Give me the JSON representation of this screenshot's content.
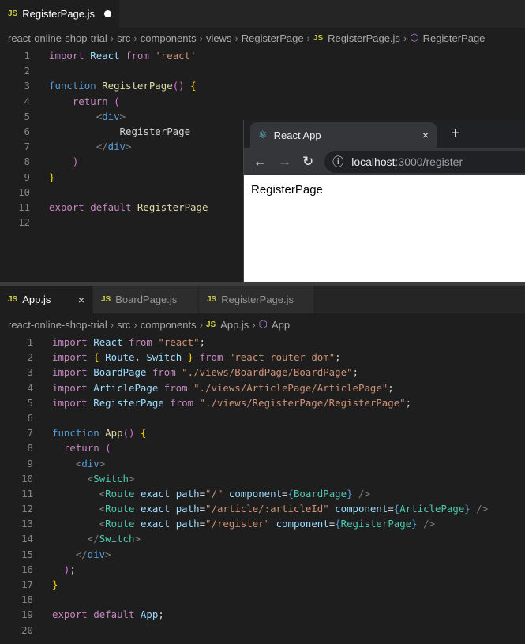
{
  "top_editor": {
    "tab": {
      "label": "RegisterPage.js",
      "icon": "JS"
    },
    "breadcrumb": [
      "react-online-shop-trial",
      "src",
      "components",
      "views",
      "RegisterPage",
      "RegisterPage.js",
      "RegisterPage"
    ],
    "lines": [
      [
        [
          "import",
          "kw"
        ],
        [
          " ",
          "pu"
        ],
        [
          "React",
          "id"
        ],
        [
          " ",
          "pu"
        ],
        [
          "from",
          "kw"
        ],
        [
          " ",
          "pu"
        ],
        [
          "'react'",
          "str"
        ]
      ],
      [],
      [
        [
          "function",
          "fn"
        ],
        [
          " ",
          "pu"
        ],
        [
          "RegisterPage",
          "fname"
        ],
        [
          "()",
          "br2"
        ],
        [
          " ",
          "pu"
        ],
        [
          "{",
          "br"
        ]
      ],
      [
        [
          "    ",
          "pu"
        ],
        [
          "return",
          "kw"
        ],
        [
          " ",
          "pu"
        ],
        [
          "(",
          "br2"
        ]
      ],
      [
        [
          "        ",
          "pu"
        ],
        [
          "<",
          "tag"
        ],
        [
          "div",
          "el"
        ],
        [
          ">",
          "tag"
        ]
      ],
      [
        [
          "            ",
          "pu"
        ],
        [
          "RegisterPage",
          "pu"
        ]
      ],
      [
        [
          "        ",
          "pu"
        ],
        [
          "</",
          "tag"
        ],
        [
          "div",
          "el"
        ],
        [
          ">",
          "tag"
        ]
      ],
      [
        [
          "    ",
          "pu"
        ],
        [
          ")",
          "br2"
        ]
      ],
      [
        [
          "}",
          "br"
        ]
      ],
      [],
      [
        [
          "export",
          "kw"
        ],
        [
          " ",
          "pu"
        ],
        [
          "default",
          "kw"
        ],
        [
          " ",
          "pu"
        ],
        [
          "RegisterPage",
          "fname"
        ]
      ],
      []
    ]
  },
  "browser": {
    "tab_title": "React App",
    "close": "×",
    "new_tab": "+",
    "back": "←",
    "forward": "→",
    "reload": "↻",
    "info": "ⓘ",
    "url_host": "localhost",
    "url_rest": ":3000/register",
    "content": "RegisterPage"
  },
  "bottom_editor": {
    "tabs": [
      {
        "label": "App.js",
        "icon": "JS",
        "close": "×"
      },
      {
        "label": "BoardPage.js",
        "icon": "JS"
      },
      {
        "label": "RegisterPage.js",
        "icon": "JS"
      }
    ],
    "breadcrumb": [
      "react-online-shop-trial",
      "src",
      "components",
      "App.js",
      "App"
    ],
    "lines": [
      [
        [
          "import",
          "kw"
        ],
        [
          " ",
          "pu"
        ],
        [
          "React",
          "id"
        ],
        [
          " ",
          "pu"
        ],
        [
          "from",
          "kw"
        ],
        [
          " ",
          "pu"
        ],
        [
          "\"react\"",
          "str"
        ],
        [
          ";",
          "pu"
        ]
      ],
      [
        [
          "import",
          "kw"
        ],
        [
          " ",
          "pu"
        ],
        [
          "{",
          "br"
        ],
        [
          " ",
          "pu"
        ],
        [
          "Route",
          "id"
        ],
        [
          ", ",
          "pu"
        ],
        [
          "Switch",
          "id"
        ],
        [
          " ",
          "pu"
        ],
        [
          "}",
          "br"
        ],
        [
          " ",
          "pu"
        ],
        [
          "from",
          "kw"
        ],
        [
          " ",
          "pu"
        ],
        [
          "\"react-router-dom\"",
          "str"
        ],
        [
          ";",
          "pu"
        ]
      ],
      [
        [
          "import",
          "kw"
        ],
        [
          " ",
          "pu"
        ],
        [
          "BoardPage",
          "id"
        ],
        [
          " ",
          "pu"
        ],
        [
          "from",
          "kw"
        ],
        [
          " ",
          "pu"
        ],
        [
          "\"./views/BoardPage/BoardPage\"",
          "str"
        ],
        [
          ";",
          "pu"
        ]
      ],
      [
        [
          "import",
          "kw"
        ],
        [
          " ",
          "pu"
        ],
        [
          "ArticlePage",
          "id"
        ],
        [
          " ",
          "pu"
        ],
        [
          "from",
          "kw"
        ],
        [
          " ",
          "pu"
        ],
        [
          "\"./views/ArticlePage/ArticlePage\"",
          "str"
        ],
        [
          ";",
          "pu"
        ]
      ],
      [
        [
          "import",
          "kw"
        ],
        [
          " ",
          "pu"
        ],
        [
          "RegisterPage",
          "id"
        ],
        [
          " ",
          "pu"
        ],
        [
          "from",
          "kw"
        ],
        [
          " ",
          "pu"
        ],
        [
          "\"./views/RegisterPage/RegisterPage\"",
          "str"
        ],
        [
          ";",
          "pu"
        ]
      ],
      [],
      [
        [
          "function",
          "fn"
        ],
        [
          " ",
          "pu"
        ],
        [
          "App",
          "fname"
        ],
        [
          "()",
          "br2"
        ],
        [
          " ",
          "pu"
        ],
        [
          "{",
          "br"
        ]
      ],
      [
        [
          "  ",
          "pu"
        ],
        [
          "return",
          "kw"
        ],
        [
          " ",
          "pu"
        ],
        [
          "(",
          "br2"
        ]
      ],
      [
        [
          "    ",
          "pu"
        ],
        [
          "<",
          "tag"
        ],
        [
          "div",
          "el"
        ],
        [
          ">",
          "tag"
        ]
      ],
      [
        [
          "      ",
          "pu"
        ],
        [
          "<",
          "tag"
        ],
        [
          "Switch",
          "comp"
        ],
        [
          ">",
          "tag"
        ]
      ],
      [
        [
          "        ",
          "pu"
        ],
        [
          "<",
          "tag"
        ],
        [
          "Route",
          "comp"
        ],
        [
          " ",
          "pu"
        ],
        [
          "exact",
          "at"
        ],
        [
          " ",
          "pu"
        ],
        [
          "path",
          "at"
        ],
        [
          "=",
          "pu"
        ],
        [
          "\"/\"",
          "str"
        ],
        [
          " ",
          "pu"
        ],
        [
          "component",
          "at"
        ],
        [
          "=",
          "pu"
        ],
        [
          "{",
          "fn"
        ],
        [
          "BoardPage",
          "comp"
        ],
        [
          "}",
          "fn"
        ],
        [
          " ",
          "pu"
        ],
        [
          "/>",
          "tag"
        ]
      ],
      [
        [
          "        ",
          "pu"
        ],
        [
          "<",
          "tag"
        ],
        [
          "Route",
          "comp"
        ],
        [
          " ",
          "pu"
        ],
        [
          "exact",
          "at"
        ],
        [
          " ",
          "pu"
        ],
        [
          "path",
          "at"
        ],
        [
          "=",
          "pu"
        ],
        [
          "\"/article/:articleId\"",
          "str"
        ],
        [
          " ",
          "pu"
        ],
        [
          "component",
          "at"
        ],
        [
          "=",
          "pu"
        ],
        [
          "{",
          "fn"
        ],
        [
          "ArticlePage",
          "comp"
        ],
        [
          "}",
          "fn"
        ],
        [
          " ",
          "pu"
        ],
        [
          "/>",
          "tag"
        ]
      ],
      [
        [
          "        ",
          "pu"
        ],
        [
          "<",
          "tag"
        ],
        [
          "Route",
          "comp"
        ],
        [
          " ",
          "pu"
        ],
        [
          "exact",
          "at"
        ],
        [
          " ",
          "pu"
        ],
        [
          "path",
          "at"
        ],
        [
          "=",
          "pu"
        ],
        [
          "\"/register\"",
          "str"
        ],
        [
          " ",
          "pu"
        ],
        [
          "component",
          "at"
        ],
        [
          "=",
          "pu"
        ],
        [
          "{",
          "fn"
        ],
        [
          "RegisterPage",
          "comp"
        ],
        [
          "}",
          "fn"
        ],
        [
          " ",
          "pu"
        ],
        [
          "/>",
          "tag"
        ]
      ],
      [
        [
          "      ",
          "pu"
        ],
        [
          "</",
          "tag"
        ],
        [
          "Switch",
          "comp"
        ],
        [
          ">",
          "tag"
        ]
      ],
      [
        [
          "    ",
          "pu"
        ],
        [
          "</",
          "tag"
        ],
        [
          "div",
          "el"
        ],
        [
          ">",
          "tag"
        ]
      ],
      [
        [
          "  ",
          "pu"
        ],
        [
          ")",
          "br2"
        ],
        [
          ";",
          "pu"
        ]
      ],
      [
        [
          "}",
          "br"
        ]
      ],
      [],
      [
        [
          "export",
          "kw"
        ],
        [
          " ",
          "pu"
        ],
        [
          "default",
          "kw"
        ],
        [
          " ",
          "pu"
        ],
        [
          "App",
          "id"
        ],
        [
          ";",
          "pu"
        ]
      ],
      []
    ]
  }
}
